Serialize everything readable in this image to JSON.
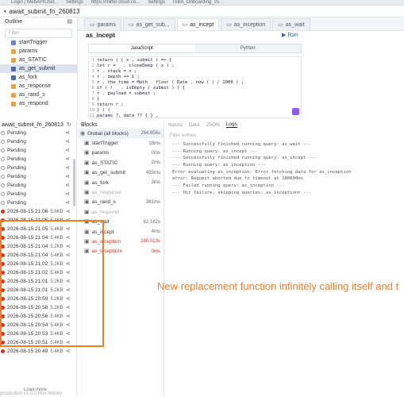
{
  "browser": {
    "tabs": [
      "Login | WebAPIChat...",
      "Settings",
      "https://mittel.cloud.co...",
      "Settings",
      "ISBA_Onboarding_2s..."
    ]
  },
  "app": {
    "title": "await_submit_fn_260813"
  },
  "editor_tabs": [
    {
      "label": "params",
      "active": false
    },
    {
      "label": "as_get_sub...",
      "active": false
    },
    {
      "label": "as_incept",
      "active": true
    },
    {
      "label": "as_inception",
      "active": false
    },
    {
      "label": "as_wait",
      "active": false
    }
  ],
  "outline": {
    "title": "Outline",
    "filter_placeholder": "Filter",
    "items": [
      {
        "label": "startTrigger",
        "color": "#6b7fd6",
        "selected": false
      },
      {
        "label": "params",
        "color": "#e8a33d",
        "selected": false
      },
      {
        "label": "as_STATIC",
        "color": "#e8a33d",
        "selected": false
      },
      {
        "label": "as_get_submit",
        "color": "#4a6fa5",
        "selected": true
      },
      {
        "label": "as_fork",
        "color": "#4a6fa5",
        "selected": false
      },
      {
        "label": "as_response",
        "color": "#e8a33d",
        "selected": false
      },
      {
        "label": "as_rand_s",
        "color": "#e8a33d",
        "selected": false
      },
      {
        "label": "as_respond",
        "color": "#e8a33d",
        "selected": false
      }
    ]
  },
  "editor": {
    "title": "as_incept",
    "run_label": "Run",
    "lang_tabs": [
      "JavaScript",
      "Python"
    ],
    "code": [
      "return ( ( x , submit ) => {",
      "  let r = _ . cloneDeep ( x ) ;",
      "  r . stack = x ;",
      "  r . depth += 1 ;",
      "  r . the_time = Math . floor ( Date . now ( ) / 1000 ) ;",
      "  if ( ! _ . isEmpty ( submit ) ) {",
      "    r . payload = submit ;",
      "  }",
      "  return r ;",
      "} ) (",
      "  params ?, data ?? { } ,"
    ]
  },
  "runs": {
    "title": "await_submit_fn_260813",
    "pending_label": "Pending",
    "pending_count": 9,
    "items": [
      {
        "time": "2026-08-15 21:06",
        "size": "5.6KB"
      },
      {
        "time": "2026-08-15 21:05",
        "size": "5.4KB"
      },
      {
        "time": "2026-08-15 21:05",
        "size": "5.4KB"
      },
      {
        "time": "2026-08-15 21:04",
        "size": "5.4KB"
      },
      {
        "time": "2026-08-15 21:04",
        "size": "5.2KB"
      },
      {
        "time": "2026-08-15 21:04",
        "size": "5.4KB"
      },
      {
        "time": "2026-08-15 21:02",
        "size": "5.2KB"
      },
      {
        "time": "2026-08-15 21:02",
        "size": "5.4KB"
      },
      {
        "time": "2026-08-15 21:01",
        "size": "5.2KB"
      },
      {
        "time": "2026-08-15 21:01",
        "size": "5.2KB"
      },
      {
        "time": "2026-08-15 20:59",
        "size": "5.2KB"
      },
      {
        "time": "2026-08-15 20:58",
        "size": "5.2KB"
      },
      {
        "time": "2026-08-15 20:56",
        "size": "5.4KB"
      },
      {
        "time": "2026-08-15 20:54",
        "size": "5.4KB"
      },
      {
        "time": "2026-08-15 20:53",
        "size": "5.4KB"
      },
      {
        "time": "2026-08-15 20:51",
        "size": "5.4KB"
      },
      {
        "time": "2026-08-15 20:49",
        "size": "5.4KB"
      }
    ],
    "load_more": "Load more"
  },
  "blocks": {
    "title": "Blocks",
    "items": [
      {
        "label": "Global (all blocks)",
        "time": "264.656s",
        "style": "global"
      },
      {
        "label": "startTrigger",
        "time": "18ms",
        "style": "normal"
      },
      {
        "label": "params",
        "time": "0ms",
        "style": "normal"
      },
      {
        "label": "as_STATIC",
        "time": "2ms",
        "style": "normal"
      },
      {
        "label": "as_get_submit",
        "time": "493ms",
        "style": "normal"
      },
      {
        "label": "as_fork",
        "time": "3ms",
        "style": "normal"
      },
      {
        "label": "as_response",
        "time": "",
        "style": "faded"
      },
      {
        "label": "as_rand_s",
        "time": "361ms",
        "style": "normal"
      },
      {
        "label": "as_respond",
        "time": "",
        "style": "faded"
      },
      {
        "label": "as_wait",
        "time": "82.162s",
        "style": "normal"
      },
      {
        "label": "as_incept",
        "time": "4ms",
        "style": "normal"
      },
      {
        "label": "as_inception",
        "time": "180.013s",
        "style": "red"
      },
      {
        "label": "as_inceptionr",
        "time": "0ms",
        "style": "red"
      }
    ]
  },
  "logs": {
    "tabs": [
      "Inputs",
      "Data",
      "JSON",
      "Logs"
    ],
    "active_tab": "Logs",
    "filter_placeholder": "Filter entries",
    "lines": [
      "--- Successfully finished running query: as_wait ---",
      "--- Running query: as_incept ---",
      "--- Successfully finished running query: as_incept ---",
      "--- Running query: as_inception ---",
      "Error evaluating as_inception: Error fetching data for as_inception",
      " error: Request aborted due to timeout at 180000ms",
      "--- Failed running query: as_inception ---",
      "--- Hit failure, skipping queries: as_inceptionr ---"
    ]
  },
  "annotation": {
    "text": "New replacement function infinitely calling itself and t",
    "color": "#f07e26"
  },
  "footer": {
    "text": "production   v1.0.2   Run history"
  }
}
